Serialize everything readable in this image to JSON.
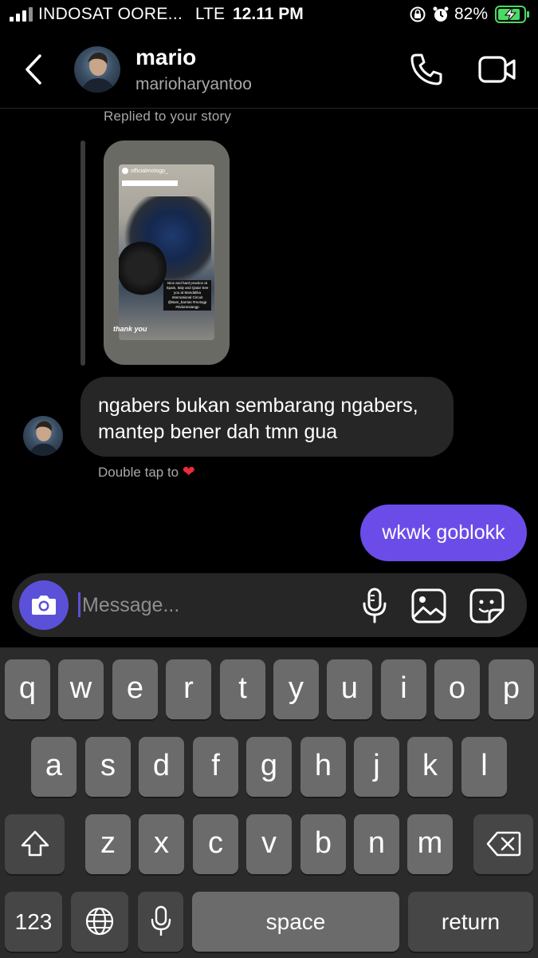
{
  "status_bar": {
    "carrier": "INDOSAT OORE...",
    "network": "LTE",
    "time": "12.11 PM",
    "battery_percent": "82%"
  },
  "header": {
    "name": "mario",
    "username": "marioharyantoo"
  },
  "chat": {
    "replied_label": "Replied to your story",
    "story": {
      "account": "officialmotogp_",
      "caption": "Nice and hard practice at Spain, Italy and Qatar See you at Mandalika International Circuit @Bam_barrias #motogp #indonesiangp",
      "thanks_text": "thank you"
    },
    "incoming_message": "ngabers bukan sembarang ngabers, mantep bener dah tmn gua",
    "double_tap_label": "Double tap to",
    "outgoing_message": "wkwk goblokk"
  },
  "composer": {
    "placeholder": "Message...",
    "accent_color": "#5b51d8"
  },
  "keyboard": {
    "row1": [
      "q",
      "w",
      "e",
      "r",
      "t",
      "y",
      "u",
      "i",
      "o",
      "p"
    ],
    "row2": [
      "a",
      "s",
      "d",
      "f",
      "g",
      "h",
      "j",
      "k",
      "l"
    ],
    "row3": [
      "z",
      "x",
      "c",
      "v",
      "b",
      "n",
      "m"
    ],
    "numbers_label": "123",
    "space_label": "space",
    "return_label": "return"
  }
}
